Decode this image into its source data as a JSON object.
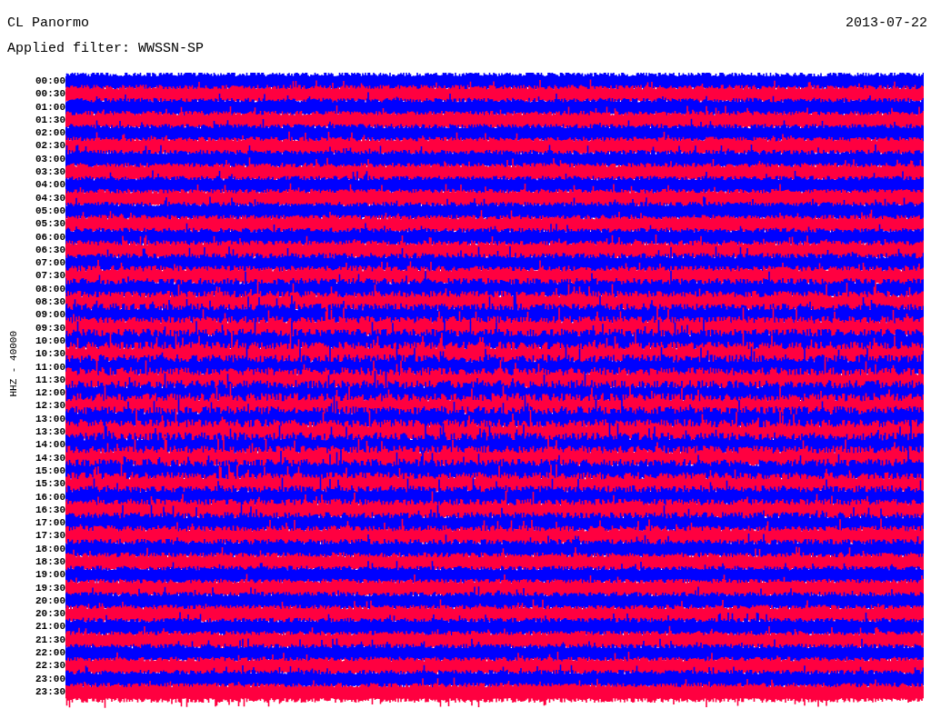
{
  "station": "CL Panormo",
  "date": "2013-07-22",
  "filter_text": "Applied filter: WWSSN-SP",
  "axis_label": "HHZ - 40000",
  "rows": [
    {
      "time": "00:00",
      "color": "#0000ff"
    },
    {
      "time": "00:30",
      "color": "#ff0040"
    },
    {
      "time": "01:00",
      "color": "#0000ff"
    },
    {
      "time": "01:30",
      "color": "#ff0040"
    },
    {
      "time": "02:00",
      "color": "#0000ff"
    },
    {
      "time": "02:30",
      "color": "#ff0040"
    },
    {
      "time": "03:00",
      "color": "#0000ff"
    },
    {
      "time": "03:30",
      "color": "#ff0040"
    },
    {
      "time": "04:00",
      "color": "#0000ff"
    },
    {
      "time": "04:30",
      "color": "#ff0040"
    },
    {
      "time": "05:00",
      "color": "#0000ff"
    },
    {
      "time": "05:30",
      "color": "#ff0040"
    },
    {
      "time": "06:00",
      "color": "#0000ff"
    },
    {
      "time": "06:30",
      "color": "#ff0040"
    },
    {
      "time": "07:00",
      "color": "#0000ff"
    },
    {
      "time": "07:30",
      "color": "#ff0040"
    },
    {
      "time": "08:00",
      "color": "#0000ff"
    },
    {
      "time": "08:30",
      "color": "#ff0040"
    },
    {
      "time": "09:00",
      "color": "#0000ff"
    },
    {
      "time": "09:30",
      "color": "#ff0040"
    },
    {
      "time": "10:00",
      "color": "#0000ff"
    },
    {
      "time": "10:30",
      "color": "#ff0040"
    },
    {
      "time": "11:00",
      "color": "#0000ff"
    },
    {
      "time": "11:30",
      "color": "#ff0040"
    },
    {
      "time": "12:00",
      "color": "#0000ff"
    },
    {
      "time": "12:30",
      "color": "#ff0040"
    },
    {
      "time": "13:00",
      "color": "#0000ff"
    },
    {
      "time": "13:30",
      "color": "#ff0040"
    },
    {
      "time": "14:00",
      "color": "#0000ff"
    },
    {
      "time": "14:30",
      "color": "#ff0040"
    },
    {
      "time": "15:00",
      "color": "#0000ff"
    },
    {
      "time": "15:30",
      "color": "#ff0040"
    },
    {
      "time": "16:00",
      "color": "#0000ff"
    },
    {
      "time": "16:30",
      "color": "#ff0040"
    },
    {
      "time": "17:00",
      "color": "#0000ff"
    },
    {
      "time": "17:30",
      "color": "#ff0040"
    },
    {
      "time": "18:00",
      "color": "#0000ff"
    },
    {
      "time": "18:30",
      "color": "#ff0040"
    },
    {
      "time": "19:00",
      "color": "#0000ff"
    },
    {
      "time": "19:30",
      "color": "#ff0040"
    },
    {
      "time": "20:00",
      "color": "#0000ff"
    },
    {
      "time": "20:30",
      "color": "#ff0040"
    },
    {
      "time": "21:00",
      "color": "#0000ff"
    },
    {
      "time": "21:30",
      "color": "#ff0040"
    },
    {
      "time": "22:00",
      "color": "#0000ff"
    },
    {
      "time": "22:30",
      "color": "#ff0040"
    },
    {
      "time": "23:00",
      "color": "#0000ff"
    },
    {
      "time": "23:30",
      "color": "#ff0040"
    }
  ]
}
